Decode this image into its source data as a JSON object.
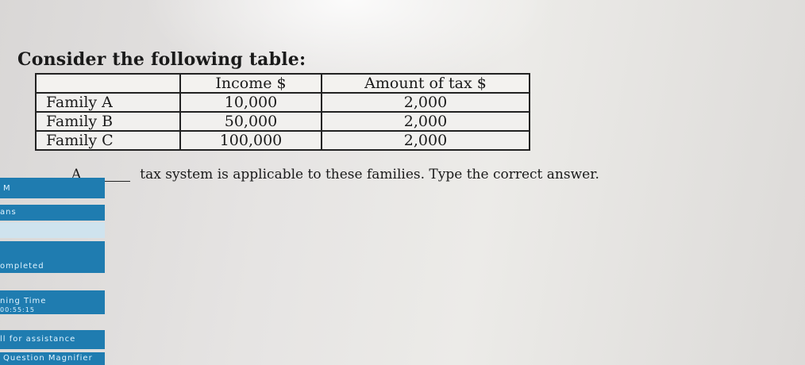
{
  "question": {
    "title": "Consider the following table:",
    "prompt_prefix": "A",
    "prompt_suffix": "tax system is applicable to these families. Type the correct answer.",
    "answer_value": ""
  },
  "table": {
    "headers": [
      "",
      "Income $",
      "Amount of tax $"
    ],
    "rows": [
      {
        "family": "Family A",
        "income": "10,000",
        "tax": "2,000"
      },
      {
        "family": "Family B",
        "income": "50,000",
        "tax": "2,000"
      },
      {
        "family": "Family C",
        "income": "100,000",
        "tax": "2,000"
      }
    ]
  },
  "sidebar": {
    "panel1": "M",
    "panel2": "ans",
    "panel4": "ompleted",
    "panel5_line1": "ning Time",
    "panel5_line2": "00:55:15",
    "panel6": "ll for assistance",
    "panel7": "Question Magnifier"
  },
  "colors": {
    "sidebar_blue": "#1f7cb0",
    "sidebar_light": "#cfe3ee"
  }
}
